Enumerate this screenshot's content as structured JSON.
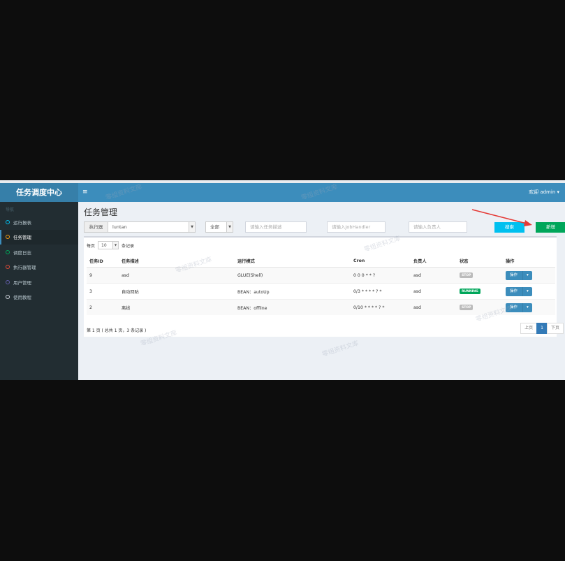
{
  "header": {
    "brand": "任务调度中心",
    "menu_icon": "≡",
    "welcome": "欢迎 admin ▾"
  },
  "sidebar": {
    "section_label": "导航",
    "items": [
      {
        "label": "运行报表",
        "ring_color": "#00c0ef"
      },
      {
        "label": "任务管理",
        "ring_color": "#f39c12"
      },
      {
        "label": "调度日志",
        "ring_color": "#00a65a"
      },
      {
        "label": "执行器管理",
        "ring_color": "#dd4b39"
      },
      {
        "label": "用户管理",
        "ring_color": "#605ca8"
      },
      {
        "label": "使用教程",
        "ring_color": "#d2d6de"
      }
    ]
  },
  "page": {
    "title": "任务管理"
  },
  "filters": {
    "executor_label": "执行器",
    "executor_value": "luntan",
    "status_value": "全部",
    "desc_placeholder": "请输入任务描述",
    "handler_placeholder": "请输入JobHandler",
    "author_placeholder": "请输入负责人",
    "search_label": "搜索",
    "add_label": "新增"
  },
  "pagesize": {
    "prefix": "每页",
    "value": "10",
    "suffix": "条记录"
  },
  "table": {
    "headers": [
      "任务ID",
      "任务描述",
      "运行模式",
      "Cron",
      "负责人",
      "状态",
      "操作"
    ],
    "rows": [
      {
        "id": "9",
        "desc": "asd",
        "mode": "GLUE(Shell)",
        "cron": "0 0 0 * * ?",
        "author": "asd",
        "status": "STOP",
        "action": "操作"
      },
      {
        "id": "3",
        "desc": "自动回贴",
        "mode": "BEAN：autoUp",
        "cron": "0/3 * * * * ? *",
        "author": "asd",
        "status": "RUNNING",
        "action": "操作"
      },
      {
        "id": "2",
        "desc": "离线",
        "mode": "BEAN：offline",
        "cron": "0/10 * * * * ? *",
        "author": "asd",
        "status": "STOP",
        "action": "操作"
      }
    ],
    "status_colors": {
      "STOP": "#bbbbbb",
      "RUNNING": "#00a65a"
    }
  },
  "pagination": {
    "info": "第 1 页 ( 总共 1 页，3 条记录 )",
    "prev": "上页",
    "current": "1",
    "next": "下页"
  },
  "watermark": "零组资料文库",
  "colors": {
    "topbar": "#3c8dbc",
    "sidebar": "#222d32",
    "search_button": "#00c0ef",
    "add_button": "#00a65a",
    "arrow": "#e53935"
  }
}
